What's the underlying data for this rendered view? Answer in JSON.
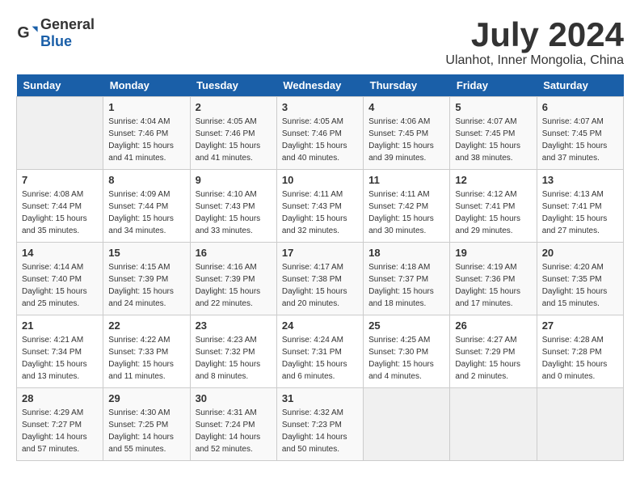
{
  "header": {
    "logo_general": "General",
    "logo_blue": "Blue",
    "title": "July 2024",
    "location": "Ulanhot, Inner Mongolia, China"
  },
  "calendar": {
    "days_of_week": [
      "Sunday",
      "Monday",
      "Tuesday",
      "Wednesday",
      "Thursday",
      "Friday",
      "Saturday"
    ],
    "weeks": [
      [
        {
          "day": "",
          "empty": true
        },
        {
          "day": "1",
          "sunrise": "4:04 AM",
          "sunset": "7:46 PM",
          "daylight": "15 hours and 41 minutes."
        },
        {
          "day": "2",
          "sunrise": "4:05 AM",
          "sunset": "7:46 PM",
          "daylight": "15 hours and 41 minutes."
        },
        {
          "day": "3",
          "sunrise": "4:05 AM",
          "sunset": "7:46 PM",
          "daylight": "15 hours and 40 minutes."
        },
        {
          "day": "4",
          "sunrise": "4:06 AM",
          "sunset": "7:45 PM",
          "daylight": "15 hours and 39 minutes."
        },
        {
          "day": "5",
          "sunrise": "4:07 AM",
          "sunset": "7:45 PM",
          "daylight": "15 hours and 38 minutes."
        },
        {
          "day": "6",
          "sunrise": "4:07 AM",
          "sunset": "7:45 PM",
          "daylight": "15 hours and 37 minutes."
        }
      ],
      [
        {
          "day": "7",
          "sunrise": "4:08 AM",
          "sunset": "7:44 PM",
          "daylight": "15 hours and 35 minutes."
        },
        {
          "day": "8",
          "sunrise": "4:09 AM",
          "sunset": "7:44 PM",
          "daylight": "15 hours and 34 minutes."
        },
        {
          "day": "9",
          "sunrise": "4:10 AM",
          "sunset": "7:43 PM",
          "daylight": "15 hours and 33 minutes."
        },
        {
          "day": "10",
          "sunrise": "4:11 AM",
          "sunset": "7:43 PM",
          "daylight": "15 hours and 32 minutes."
        },
        {
          "day": "11",
          "sunrise": "4:11 AM",
          "sunset": "7:42 PM",
          "daylight": "15 hours and 30 minutes."
        },
        {
          "day": "12",
          "sunrise": "4:12 AM",
          "sunset": "7:41 PM",
          "daylight": "15 hours and 29 minutes."
        },
        {
          "day": "13",
          "sunrise": "4:13 AM",
          "sunset": "7:41 PM",
          "daylight": "15 hours and 27 minutes."
        }
      ],
      [
        {
          "day": "14",
          "sunrise": "4:14 AM",
          "sunset": "7:40 PM",
          "daylight": "15 hours and 25 minutes."
        },
        {
          "day": "15",
          "sunrise": "4:15 AM",
          "sunset": "7:39 PM",
          "daylight": "15 hours and 24 minutes."
        },
        {
          "day": "16",
          "sunrise": "4:16 AM",
          "sunset": "7:39 PM",
          "daylight": "15 hours and 22 minutes."
        },
        {
          "day": "17",
          "sunrise": "4:17 AM",
          "sunset": "7:38 PM",
          "daylight": "15 hours and 20 minutes."
        },
        {
          "day": "18",
          "sunrise": "4:18 AM",
          "sunset": "7:37 PM",
          "daylight": "15 hours and 18 minutes."
        },
        {
          "day": "19",
          "sunrise": "4:19 AM",
          "sunset": "7:36 PM",
          "daylight": "15 hours and 17 minutes."
        },
        {
          "day": "20",
          "sunrise": "4:20 AM",
          "sunset": "7:35 PM",
          "daylight": "15 hours and 15 minutes."
        }
      ],
      [
        {
          "day": "21",
          "sunrise": "4:21 AM",
          "sunset": "7:34 PM",
          "daylight": "15 hours and 13 minutes."
        },
        {
          "day": "22",
          "sunrise": "4:22 AM",
          "sunset": "7:33 PM",
          "daylight": "15 hours and 11 minutes."
        },
        {
          "day": "23",
          "sunrise": "4:23 AM",
          "sunset": "7:32 PM",
          "daylight": "15 hours and 8 minutes."
        },
        {
          "day": "24",
          "sunrise": "4:24 AM",
          "sunset": "7:31 PM",
          "daylight": "15 hours and 6 minutes."
        },
        {
          "day": "25",
          "sunrise": "4:25 AM",
          "sunset": "7:30 PM",
          "daylight": "15 hours and 4 minutes."
        },
        {
          "day": "26",
          "sunrise": "4:27 AM",
          "sunset": "7:29 PM",
          "daylight": "15 hours and 2 minutes."
        },
        {
          "day": "27",
          "sunrise": "4:28 AM",
          "sunset": "7:28 PM",
          "daylight": "15 hours and 0 minutes."
        }
      ],
      [
        {
          "day": "28",
          "sunrise": "4:29 AM",
          "sunset": "7:27 PM",
          "daylight": "14 hours and 57 minutes."
        },
        {
          "day": "29",
          "sunrise": "4:30 AM",
          "sunset": "7:25 PM",
          "daylight": "14 hours and 55 minutes."
        },
        {
          "day": "30",
          "sunrise": "4:31 AM",
          "sunset": "7:24 PM",
          "daylight": "14 hours and 52 minutes."
        },
        {
          "day": "31",
          "sunrise": "4:32 AM",
          "sunset": "7:23 PM",
          "daylight": "14 hours and 50 minutes."
        },
        {
          "day": "",
          "empty": true
        },
        {
          "day": "",
          "empty": true
        },
        {
          "day": "",
          "empty": true
        }
      ]
    ]
  }
}
